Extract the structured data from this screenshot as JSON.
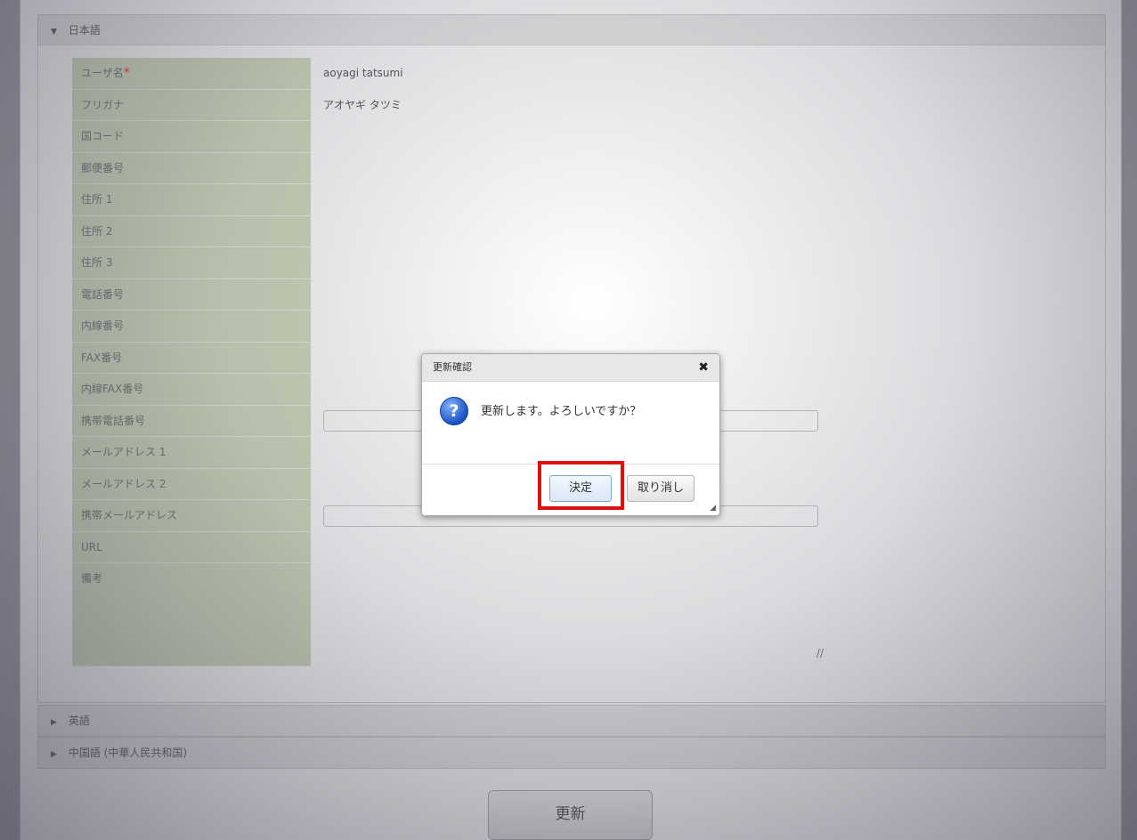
{
  "sections": {
    "japanese": {
      "title": "日本語",
      "expanded": true
    },
    "english": {
      "title": "英語",
      "expanded": false
    },
    "chinese": {
      "title": "中国語 (中華人民共和国)",
      "expanded": false
    }
  },
  "form": {
    "rows": [
      {
        "label": "ユーザ名",
        "required": true,
        "value": "aoyagi tatsumi"
      },
      {
        "label": "フリガナ",
        "value": "アオヤギ タツミ"
      },
      {
        "label": "国コード",
        "value": ""
      },
      {
        "label": "郵便番号",
        "value": ""
      },
      {
        "label": "住所 1",
        "value": ""
      },
      {
        "label": "住所 2",
        "value": ""
      },
      {
        "label": "住所 3",
        "value": ""
      },
      {
        "label": "電話番号",
        "value": ""
      },
      {
        "label": "内線番号",
        "value": ""
      },
      {
        "label": "FAX番号",
        "value": ""
      },
      {
        "label": "内線FAX番号",
        "value": ""
      },
      {
        "label": "携帯電話番号",
        "value": ""
      },
      {
        "label": "メールアドレス 1",
        "value": ""
      },
      {
        "label": "メールアドレス 2",
        "value": ""
      },
      {
        "label": "携帯メールアドレス",
        "value": ""
      },
      {
        "label": "URL",
        "value": ""
      },
      {
        "label": "備考",
        "value": ""
      }
    ],
    "required_mark": "*"
  },
  "dialog": {
    "title": "更新確認",
    "close_glyph": "✖",
    "icon_glyph": "?",
    "message": "更新します。よろしいですか？",
    "ok_label": "決定",
    "cancel_label": "取り消し"
  },
  "update_button": {
    "label": "更新"
  },
  "icons": {
    "expanded": "▼",
    "collapsed": "▶",
    "resize": "//"
  },
  "colors": {
    "label_bg": "#c9d4b0",
    "highlight": "#e01010",
    "required": "#e00000"
  }
}
